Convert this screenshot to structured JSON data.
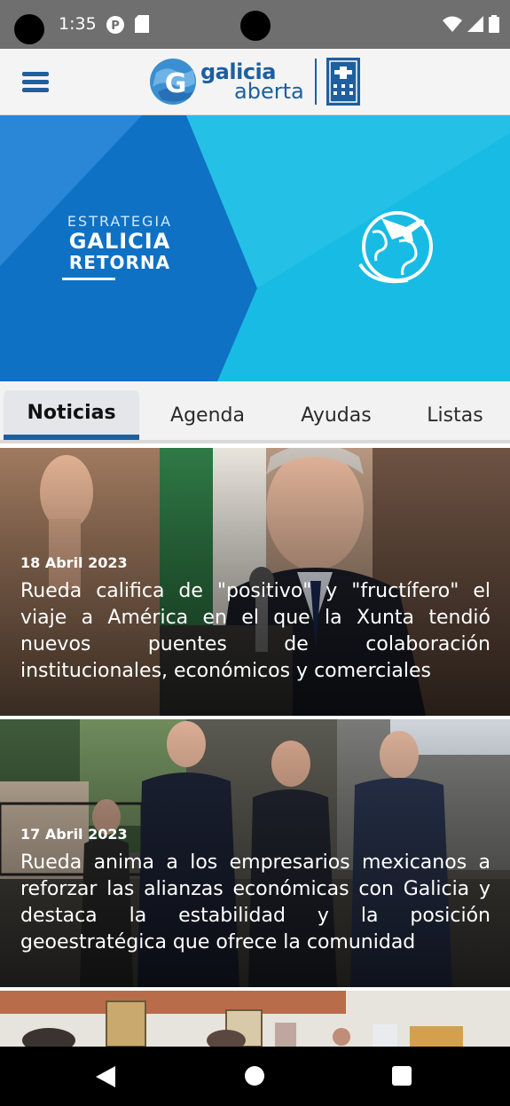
{
  "status_bar": {
    "time": "1:35"
  },
  "app": {
    "logo_line1": "galicia",
    "logo_line2": "aberta",
    "brand_color": "#1d5fa0"
  },
  "banner": {
    "line1": "ESTRATEGIA",
    "line2": "GALICIA",
    "line3": "RETORNA",
    "icon": "globe-plane-icon"
  },
  "tabs": [
    {
      "label": "Noticias",
      "active": true
    },
    {
      "label": "Agenda",
      "active": false
    },
    {
      "label": "Ayudas",
      "active": false
    },
    {
      "label": "Listas",
      "active": false
    }
  ],
  "news": [
    {
      "date": "18 Abril 2023",
      "title": "Rueda califica de \"positivo\" y \"fructífero\" el viaje a América en el que la Xunta tendió nuevos puentes de colaboración institucionales, económicos y comerciales"
    },
    {
      "date": "17 Abril 2023",
      "title": "Rueda anima a los empresarios mexicanos a reforzar las alianzas económicas con Galicia y destaca la estabilidad y la posición geoestratégica que ofrece la comunidad"
    }
  ]
}
